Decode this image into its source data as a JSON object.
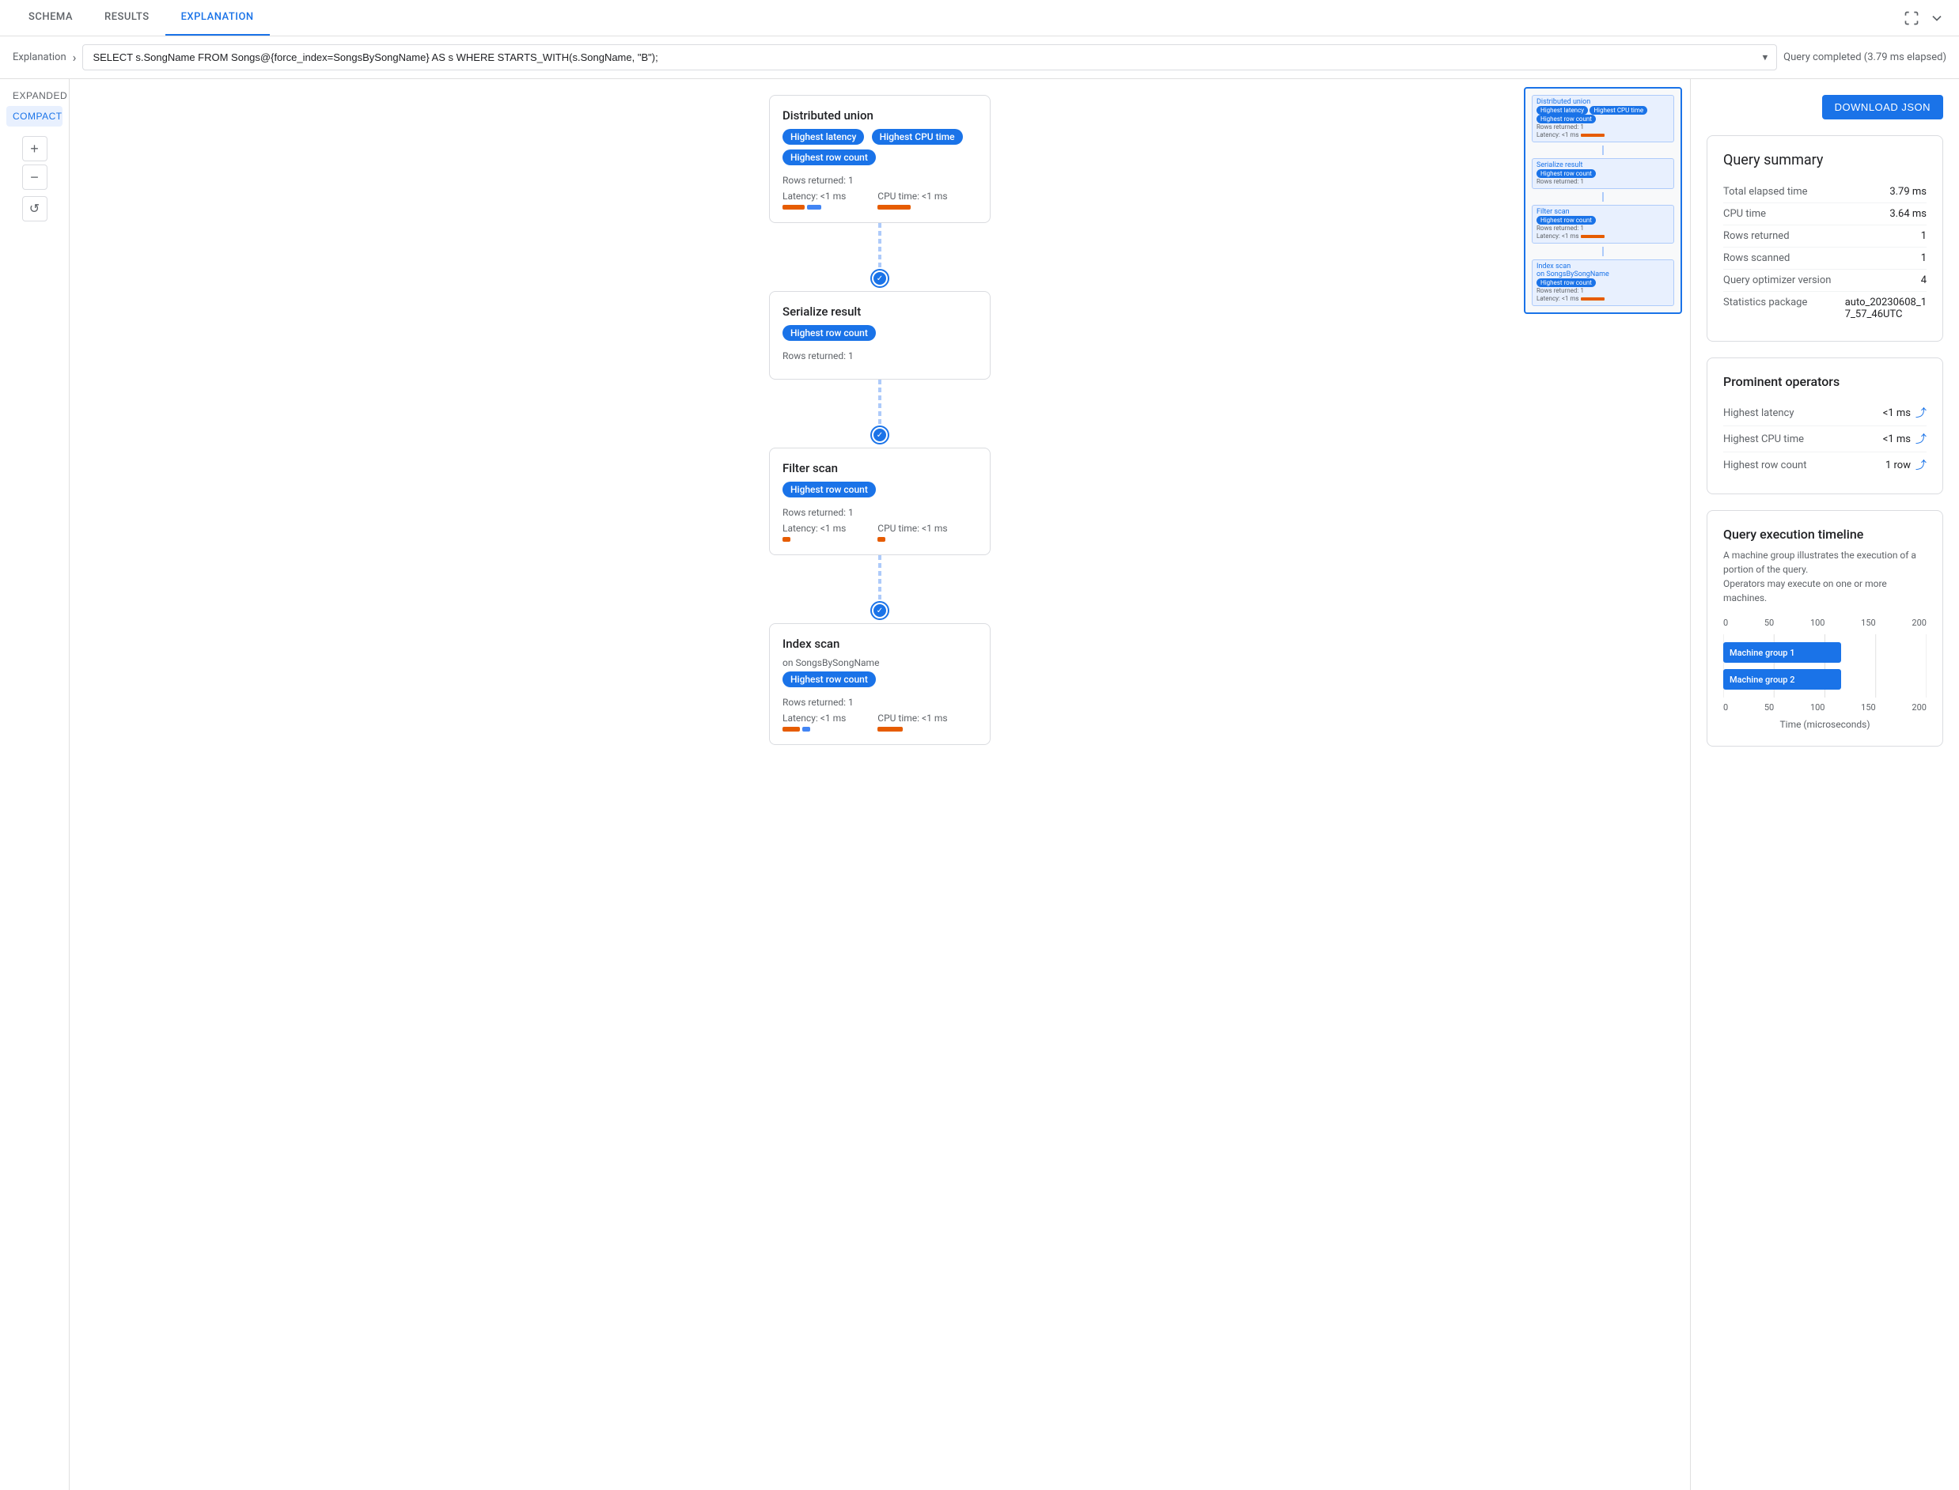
{
  "tabs": {
    "schema": "SCHEMA",
    "results": "RESULTS",
    "explanation": "EXPLANATION",
    "active": "EXPLANATION"
  },
  "query_bar": {
    "breadcrumb": "Explanation",
    "query_text": "SELECT s.SongName FROM Songs@{force_index=SongsBySongName} AS s WHERE STARTS_WITH(s.SongName, \"B\");",
    "status": "Query completed (3.79 ms elapsed)"
  },
  "view_controls": {
    "expanded": "EXPANDED",
    "compact": "COMPACT"
  },
  "operators": [
    {
      "id": "distributed-union",
      "title": "Distributed union",
      "badges": [
        "Highest latency",
        "Highest CPU time",
        "Highest row count"
      ],
      "rows_returned": "Rows returned: 1",
      "latency_label": "Latency: <1 ms",
      "cpu_label": "CPU time: <1 ms",
      "show_bars": true
    },
    {
      "id": "serialize-result",
      "title": "Serialize result",
      "badges": [
        "Highest row count"
      ],
      "rows_returned": "Rows returned: 1",
      "latency_label": null,
      "cpu_label": null,
      "show_bars": false
    },
    {
      "id": "filter-scan",
      "title": "Filter scan",
      "badges": [
        "Highest row count"
      ],
      "rows_returned": "Rows returned: 1",
      "latency_label": "Latency: <1 ms",
      "cpu_label": "CPU time: <1 ms",
      "show_bars": true
    },
    {
      "id": "index-scan",
      "title": "Index scan",
      "subtitle": "on SongsBySongName",
      "badges": [
        "Highest row count"
      ],
      "rows_returned": "Rows returned: 1",
      "latency_label": "Latency: <1 ms",
      "cpu_label": "CPU time: <1 ms",
      "show_bars": true
    }
  ],
  "download_button": "DOWNLOAD JSON",
  "query_summary": {
    "title": "Query summary",
    "rows": [
      {
        "key": "Total elapsed time",
        "value": "3.79 ms"
      },
      {
        "key": "CPU time",
        "value": "3.64 ms"
      },
      {
        "key": "Rows returned",
        "value": "1"
      },
      {
        "key": "Rows scanned",
        "value": "1"
      },
      {
        "key": "Query optimizer version",
        "value": "4"
      },
      {
        "key": "Statistics package",
        "value": "auto_20230608_17_57_46UTC"
      }
    ]
  },
  "prominent_operators": {
    "title": "Prominent operators",
    "rows": [
      {
        "key": "Highest latency",
        "value": "<1 ms"
      },
      {
        "key": "Highest CPU time",
        "value": "<1 ms"
      },
      {
        "key": "Highest row count",
        "value": "1 row"
      }
    ]
  },
  "timeline": {
    "title": "Query execution timeline",
    "description_line1": "A machine group illustrates the execution of a portion of the query.",
    "description_line2": "Operators may execute on one or more machines.",
    "axis_labels": [
      "0",
      "50",
      "100",
      "150",
      "200"
    ],
    "bars": [
      {
        "label": "Machine group 1",
        "width_pct": 60,
        "left_pct": 0
      },
      {
        "label": "Machine group 2",
        "width_pct": 60,
        "left_pct": 0
      }
    ],
    "axis_title": "Time (microseconds)"
  }
}
